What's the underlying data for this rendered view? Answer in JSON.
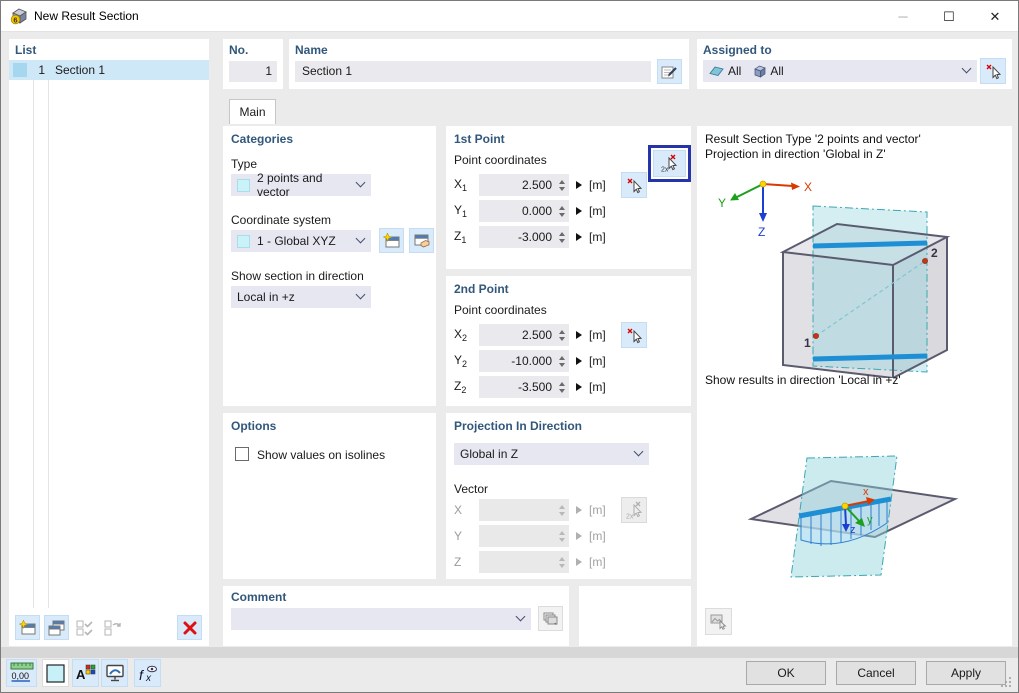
{
  "window": {
    "title": "New Result Section"
  },
  "list_panel": {
    "header": "List",
    "item": {
      "no": "1",
      "name": "Section 1"
    }
  },
  "no_field": {
    "label": "No.",
    "value": "1"
  },
  "name_field": {
    "label": "Name",
    "value": "Section 1"
  },
  "assigned_to": {
    "label": "Assigned to",
    "surfaces_value": "All",
    "solids_value": "All"
  },
  "tabs": {
    "main": "Main"
  },
  "categories": {
    "header": "Categories",
    "type_label": "Type",
    "type_value": "2 points and vector",
    "cs_label": "Coordinate system",
    "cs_value": "1 - Global XYZ",
    "dir_label": "Show section in direction",
    "dir_value": "Local in +z"
  },
  "first_point": {
    "header": "1st Point",
    "coords_label": "Point coordinates",
    "x": {
      "label": "X",
      "sub": "1",
      "value": "2.500",
      "unit": "[m]"
    },
    "y": {
      "label": "Y",
      "sub": "1",
      "value": "0.000",
      "unit": "[m]"
    },
    "z": {
      "label": "Z",
      "sub": "1",
      "value": "-3.000",
      "unit": "[m]"
    }
  },
  "second_point": {
    "header": "2nd Point",
    "coords_label": "Point coordinates",
    "x": {
      "label": "X",
      "sub": "2",
      "value": "2.500",
      "unit": "[m]"
    },
    "y": {
      "label": "Y",
      "sub": "2",
      "value": "-10.000",
      "unit": "[m]"
    },
    "z": {
      "label": "Z",
      "sub": "2",
      "value": "-3.500",
      "unit": "[m]"
    }
  },
  "options": {
    "header": "Options",
    "show_values_label": "Show values on isolines",
    "checked": false
  },
  "projection": {
    "header": "Projection In Direction",
    "value": "Global in Z",
    "vector_label": "Vector",
    "x": {
      "label": "X",
      "unit": "[m]"
    },
    "y": {
      "label": "Y",
      "unit": "[m]"
    },
    "z": {
      "label": "Z",
      "unit": "[m]"
    }
  },
  "comment": {
    "header": "Comment",
    "value": ""
  },
  "preview": {
    "caption1_line1": "Result Section Type '2 points and vector'",
    "caption1_line2": "Projection in direction 'Global in Z'",
    "caption2": "Show results in direction 'Local in +z'",
    "point1": "1",
    "point2": "2",
    "triad1": {
      "x": "X",
      "y": "Y",
      "z": "Z"
    },
    "triad2": {
      "x": "x",
      "y": "y",
      "z": "z"
    }
  },
  "buttons": {
    "ok": "OK",
    "cancel": "Cancel",
    "apply": "Apply"
  },
  "colors": {
    "focus_border": "#2634a9",
    "selection": "#cfe8f8",
    "pick_button": "#d9eafa",
    "header_text": "#31577b",
    "section_line": "#1e8fd5",
    "plane_teal": "#8fcfd9",
    "axis_x": "#d93a00",
    "axis_y": "#1da01d",
    "axis_z": "#1a3fd1"
  }
}
